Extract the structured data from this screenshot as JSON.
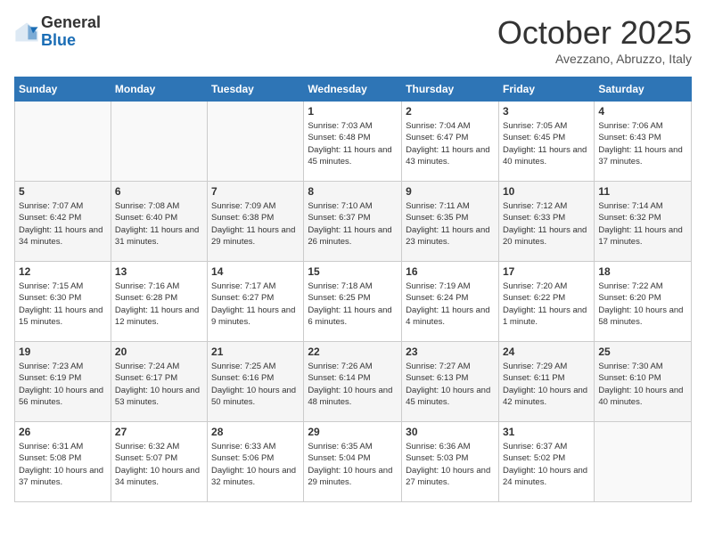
{
  "logo": {
    "general": "General",
    "blue": "Blue"
  },
  "header": {
    "title": "October 2025",
    "subtitle": "Avezzano, Abruzzo, Italy"
  },
  "weekdays": [
    "Sunday",
    "Monday",
    "Tuesday",
    "Wednesday",
    "Thursday",
    "Friday",
    "Saturday"
  ],
  "weeks": [
    [
      {
        "day": "",
        "info": ""
      },
      {
        "day": "",
        "info": ""
      },
      {
        "day": "",
        "info": ""
      },
      {
        "day": "1",
        "info": "Sunrise: 7:03 AM\nSunset: 6:48 PM\nDaylight: 11 hours and 45 minutes."
      },
      {
        "day": "2",
        "info": "Sunrise: 7:04 AM\nSunset: 6:47 PM\nDaylight: 11 hours and 43 minutes."
      },
      {
        "day": "3",
        "info": "Sunrise: 7:05 AM\nSunset: 6:45 PM\nDaylight: 11 hours and 40 minutes."
      },
      {
        "day": "4",
        "info": "Sunrise: 7:06 AM\nSunset: 6:43 PM\nDaylight: 11 hours and 37 minutes."
      }
    ],
    [
      {
        "day": "5",
        "info": "Sunrise: 7:07 AM\nSunset: 6:42 PM\nDaylight: 11 hours and 34 minutes."
      },
      {
        "day": "6",
        "info": "Sunrise: 7:08 AM\nSunset: 6:40 PM\nDaylight: 11 hours and 31 minutes."
      },
      {
        "day": "7",
        "info": "Sunrise: 7:09 AM\nSunset: 6:38 PM\nDaylight: 11 hours and 29 minutes."
      },
      {
        "day": "8",
        "info": "Sunrise: 7:10 AM\nSunset: 6:37 PM\nDaylight: 11 hours and 26 minutes."
      },
      {
        "day": "9",
        "info": "Sunrise: 7:11 AM\nSunset: 6:35 PM\nDaylight: 11 hours and 23 minutes."
      },
      {
        "day": "10",
        "info": "Sunrise: 7:12 AM\nSunset: 6:33 PM\nDaylight: 11 hours and 20 minutes."
      },
      {
        "day": "11",
        "info": "Sunrise: 7:14 AM\nSunset: 6:32 PM\nDaylight: 11 hours and 17 minutes."
      }
    ],
    [
      {
        "day": "12",
        "info": "Sunrise: 7:15 AM\nSunset: 6:30 PM\nDaylight: 11 hours and 15 minutes."
      },
      {
        "day": "13",
        "info": "Sunrise: 7:16 AM\nSunset: 6:28 PM\nDaylight: 11 hours and 12 minutes."
      },
      {
        "day": "14",
        "info": "Sunrise: 7:17 AM\nSunset: 6:27 PM\nDaylight: 11 hours and 9 minutes."
      },
      {
        "day": "15",
        "info": "Sunrise: 7:18 AM\nSunset: 6:25 PM\nDaylight: 11 hours and 6 minutes."
      },
      {
        "day": "16",
        "info": "Sunrise: 7:19 AM\nSunset: 6:24 PM\nDaylight: 11 hours and 4 minutes."
      },
      {
        "day": "17",
        "info": "Sunrise: 7:20 AM\nSunset: 6:22 PM\nDaylight: 11 hours and 1 minute."
      },
      {
        "day": "18",
        "info": "Sunrise: 7:22 AM\nSunset: 6:20 PM\nDaylight: 10 hours and 58 minutes."
      }
    ],
    [
      {
        "day": "19",
        "info": "Sunrise: 7:23 AM\nSunset: 6:19 PM\nDaylight: 10 hours and 56 minutes."
      },
      {
        "day": "20",
        "info": "Sunrise: 7:24 AM\nSunset: 6:17 PM\nDaylight: 10 hours and 53 minutes."
      },
      {
        "day": "21",
        "info": "Sunrise: 7:25 AM\nSunset: 6:16 PM\nDaylight: 10 hours and 50 minutes."
      },
      {
        "day": "22",
        "info": "Sunrise: 7:26 AM\nSunset: 6:14 PM\nDaylight: 10 hours and 48 minutes."
      },
      {
        "day": "23",
        "info": "Sunrise: 7:27 AM\nSunset: 6:13 PM\nDaylight: 10 hours and 45 minutes."
      },
      {
        "day": "24",
        "info": "Sunrise: 7:29 AM\nSunset: 6:11 PM\nDaylight: 10 hours and 42 minutes."
      },
      {
        "day": "25",
        "info": "Sunrise: 7:30 AM\nSunset: 6:10 PM\nDaylight: 10 hours and 40 minutes."
      }
    ],
    [
      {
        "day": "26",
        "info": "Sunrise: 6:31 AM\nSunset: 5:08 PM\nDaylight: 10 hours and 37 minutes."
      },
      {
        "day": "27",
        "info": "Sunrise: 6:32 AM\nSunset: 5:07 PM\nDaylight: 10 hours and 34 minutes."
      },
      {
        "day": "28",
        "info": "Sunrise: 6:33 AM\nSunset: 5:06 PM\nDaylight: 10 hours and 32 minutes."
      },
      {
        "day": "29",
        "info": "Sunrise: 6:35 AM\nSunset: 5:04 PM\nDaylight: 10 hours and 29 minutes."
      },
      {
        "day": "30",
        "info": "Sunrise: 6:36 AM\nSunset: 5:03 PM\nDaylight: 10 hours and 27 minutes."
      },
      {
        "day": "31",
        "info": "Sunrise: 6:37 AM\nSunset: 5:02 PM\nDaylight: 10 hours and 24 minutes."
      },
      {
        "day": "",
        "info": ""
      }
    ]
  ]
}
